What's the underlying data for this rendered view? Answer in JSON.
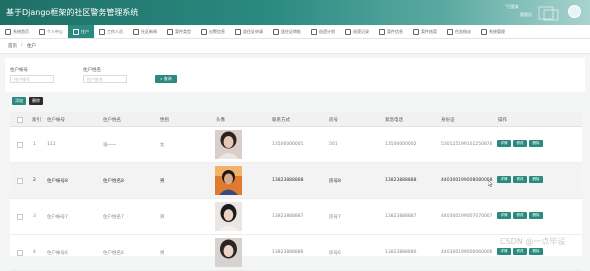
{
  "header": {
    "title": "基于Django框架的社区警务管理系统",
    "user_label": "\"已登录",
    "role_label": "管理员"
  },
  "nav": [
    {
      "label": "系统首页",
      "icon": "home-icon",
      "active": false
    },
    {
      "label": "个人中心",
      "icon": "person-icon",
      "active": false
    },
    {
      "label": "住户",
      "icon": "resident-icon",
      "active": true
    },
    {
      "label": "工作人员",
      "icon": "staff-icon",
      "active": false
    },
    {
      "label": "社区新闻",
      "icon": "news-icon",
      "active": false
    },
    {
      "label": "案件类型",
      "icon": "case-type-icon",
      "active": false
    },
    {
      "label": "出警信息",
      "icon": "police-icon",
      "active": false
    },
    {
      "label": "居住证申请",
      "icon": "permit-apply-icon",
      "active": false
    },
    {
      "label": "居住证审批",
      "icon": "permit-approve-icon",
      "active": false
    },
    {
      "label": "巡逻计划",
      "icon": "patrol-plan-icon",
      "active": false
    },
    {
      "label": "巡逻记录",
      "icon": "patrol-record-icon",
      "active": false
    },
    {
      "label": "案件信息",
      "icon": "case-info-icon",
      "active": false
    },
    {
      "label": "案件结案",
      "icon": "case-close-icon",
      "active": false
    },
    {
      "label": "任务指派",
      "icon": "task-icon",
      "active": false
    },
    {
      "label": "系统管理",
      "icon": "settings-icon",
      "active": false
    }
  ],
  "breadcrumb": {
    "home": "首页",
    "sep": "/",
    "current": "住户"
  },
  "search": {
    "field1_label": "住户帐号",
    "field1_placeholder": "住户帐号",
    "field2_label": "住户姓名",
    "field2_placeholder": "住户姓名",
    "button_label": "查询"
  },
  "actions": {
    "add_label": "添加",
    "delete_label": "删除"
  },
  "table": {
    "headers": [
      "索引",
      "住户帐号",
      "住户姓名",
      "性别",
      "头像",
      "联系方式",
      "房号",
      "紧急电话",
      "身份证",
      "操作"
    ],
    "row_buttons": {
      "view": "详情",
      "edit": "修改",
      "delete": "删除"
    },
    "rows": [
      {
        "index": "1",
        "account": "111",
        "name": "张一一",
        "gender": "女",
        "phone": "13500000001",
        "room": "501",
        "emergency": "13500000002",
        "id_card": "530125199101250876",
        "highlight": false
      },
      {
        "index": "2",
        "account": "住户帐号8",
        "name": "住户姓名8",
        "gender": "男",
        "phone": "13823888888",
        "room": "房号8",
        "emergency": "13823888888",
        "id_card": "440300199008080008",
        "highlight": true
      },
      {
        "index": "3",
        "account": "住户帐号7",
        "name": "住户姓名7",
        "gender": "男",
        "phone": "13823888887",
        "room": "房号7",
        "emergency": "13823888887",
        "id_card": "440300199007070007",
        "highlight": false
      },
      {
        "index": "4",
        "account": "住户帐号6",
        "name": "住户姓名6",
        "gender": "男",
        "phone": "13823888886",
        "room": "房号6",
        "emergency": "13823888886",
        "id_card": "440300199006060006",
        "highlight": false
      }
    ]
  },
  "watermark": "CSDN @一点毕设",
  "colors": {
    "primary": "#2a8a80",
    "danger": "#2b2b2b",
    "header_dark": "#1f6e66"
  }
}
